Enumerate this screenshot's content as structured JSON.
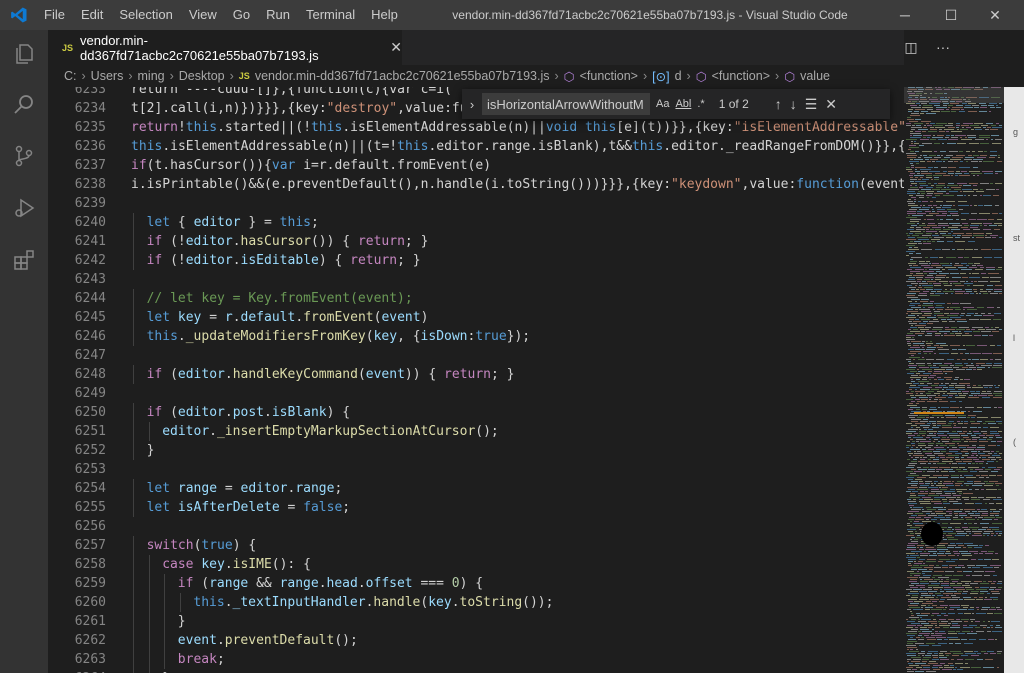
{
  "window": {
    "title": "vendor.min-dd367fd71acbc2c70621e55ba07b7193.js - Visual Studio Code",
    "menu": [
      "File",
      "Edit",
      "Selection",
      "View",
      "Go",
      "Run",
      "Terminal",
      "Help"
    ],
    "controls": {
      "minimize": "─",
      "maximize": "☐",
      "close": "✕"
    }
  },
  "activity_bar": [
    "files-icon",
    "search-icon",
    "source-control-icon",
    "run-debug-icon",
    "extensions-icon"
  ],
  "tab": {
    "badge": "JS",
    "name": "vendor.min-dd367fd71acbc2c70621e55ba07b7193.js",
    "close": "✕",
    "split": "◫",
    "more": "···"
  },
  "breadcrumb": [
    "C:",
    "Users",
    "ming",
    "Desktop",
    "vendor.min-dd367fd71acbc2c70621e55ba07b7193.js",
    "<function>",
    "d",
    "<function>",
    "value"
  ],
  "breadcrumb_js_badge": "JS",
  "find": {
    "query": "isHorizontalArrowWithoutM",
    "match_case": "Aa",
    "whole_word": "Abl",
    "regex": ".*",
    "result": "1 of 2",
    "prev": "↑",
    "next": "↓",
    "selection": "☰",
    "close": "✕",
    "toggle": "›"
  },
  "scroll_strip_marks": [
    "g",
    "st",
    "l",
    "("
  ],
  "colors": {
    "accent": "#007acc",
    "editor_bg": "#1e1e1e",
    "titlebar": "#3c3c3c",
    "activity": "#333333",
    "keyword": "#569cd6",
    "control": "#c586c0",
    "variable": "#9cdcfe",
    "function": "#dcdcaa",
    "string": "#ce9178",
    "comment": "#6a9955"
  },
  "lines": [
    {
      "n": "6233",
      "indent": 0,
      "tokens": [
        [
          "p",
          "return ----cuuu-[]},{function(c){var c=i("
        ]
      ]
    },
    {
      "n": "6234",
      "indent": 0,
      "tokens": [
        [
          "p",
          "t[2].call(i,n)})}}},{key:"
        ],
        [
          "s",
          "\"destroy\""
        ],
        [
          "p",
          ",value:fun"
        ]
      ]
    },
    {
      "n": "6235",
      "indent": 0,
      "tokens": [
        [
          "c",
          "return"
        ],
        [
          "p",
          "!"
        ],
        [
          "k",
          "this"
        ],
        [
          "p",
          ".started||(!"
        ],
        [
          "k",
          "this"
        ],
        [
          "p",
          ".isElementAddressable(n)||"
        ],
        [
          "k",
          "void this"
        ],
        [
          "p",
          "[e](t))}},{key:"
        ],
        [
          "s",
          "\"isElementAddressable\""
        ],
        [
          "p",
          ","
        ]
      ]
    },
    {
      "n": "6236",
      "indent": 0,
      "tokens": [
        [
          "k",
          "this"
        ],
        [
          "p",
          ".isElementAddressable(n)||(t=!"
        ],
        [
          "k",
          "this"
        ],
        [
          "p",
          ".editor.range.isBlank),t&&"
        ],
        [
          "k",
          "this"
        ],
        [
          "p",
          ".editor._readRangeFromDOM()}},{k"
        ]
      ]
    },
    {
      "n": "6237",
      "indent": 0,
      "tokens": [
        [
          "c",
          "if"
        ],
        [
          "p",
          "(t.hasCursor()){"
        ],
        [
          "k",
          "var"
        ],
        [
          "p",
          " i=r.default.fromEvent(e)"
        ]
      ]
    },
    {
      "n": "6238",
      "indent": 0,
      "tokens": [
        [
          "p",
          "i.isPrintable()&&(e.preventDefault(),n.handle(i.toString()))}}},{key:"
        ],
        [
          "s",
          "\"keydown\""
        ],
        [
          "p",
          ",value:"
        ],
        [
          "k",
          "function"
        ],
        [
          "p",
          "(event)"
        ]
      ]
    },
    {
      "n": "6239",
      "indent": 0,
      "tokens": []
    },
    {
      "n": "6240",
      "indent": 1,
      "tokens": [
        [
          "k",
          "let"
        ],
        [
          "p",
          " { "
        ],
        [
          "v",
          "editor"
        ],
        [
          "p",
          " } = "
        ],
        [
          "k",
          "this"
        ],
        [
          "p",
          ";"
        ]
      ]
    },
    {
      "n": "6241",
      "indent": 1,
      "tokens": [
        [
          "c",
          "if"
        ],
        [
          "p",
          " (!"
        ],
        [
          "v",
          "editor"
        ],
        [
          "p",
          "."
        ],
        [
          "f",
          "hasCursor"
        ],
        [
          "p",
          "()) { "
        ],
        [
          "c",
          "return"
        ],
        [
          "p",
          "; }"
        ]
      ]
    },
    {
      "n": "6242",
      "indent": 1,
      "tokens": [
        [
          "c",
          "if"
        ],
        [
          "p",
          " (!"
        ],
        [
          "v",
          "editor"
        ],
        [
          "p",
          "."
        ],
        [
          "v",
          "isEditable"
        ],
        [
          "p",
          ") { "
        ],
        [
          "c",
          "return"
        ],
        [
          "p",
          "; }"
        ]
      ]
    },
    {
      "n": "6243",
      "indent": 0,
      "tokens": []
    },
    {
      "n": "6244",
      "indent": 1,
      "tokens": [
        [
          "cm",
          "// let key = Key.fromEvent(event);"
        ]
      ]
    },
    {
      "n": "6245",
      "indent": 1,
      "tokens": [
        [
          "k",
          "let"
        ],
        [
          "p",
          " "
        ],
        [
          "v",
          "key"
        ],
        [
          "p",
          " = "
        ],
        [
          "v",
          "r"
        ],
        [
          "p",
          "."
        ],
        [
          "v",
          "default"
        ],
        [
          "p",
          "."
        ],
        [
          "f",
          "fromEvent"
        ],
        [
          "p",
          "("
        ],
        [
          "v",
          "event"
        ],
        [
          "p",
          ")"
        ]
      ]
    },
    {
      "n": "6246",
      "indent": 1,
      "tokens": [
        [
          "k",
          "this"
        ],
        [
          "p",
          "."
        ],
        [
          "f",
          "_updateModifiersFromKey"
        ],
        [
          "p",
          "("
        ],
        [
          "v",
          "key"
        ],
        [
          "p",
          ", {"
        ],
        [
          "v",
          "isDown"
        ],
        [
          "p",
          ":"
        ],
        [
          "k",
          "true"
        ],
        [
          "p",
          "});"
        ]
      ]
    },
    {
      "n": "6247",
      "indent": 0,
      "tokens": []
    },
    {
      "n": "6248",
      "indent": 1,
      "tokens": [
        [
          "c",
          "if"
        ],
        [
          "p",
          " ("
        ],
        [
          "v",
          "editor"
        ],
        [
          "p",
          "."
        ],
        [
          "f",
          "handleKeyCommand"
        ],
        [
          "p",
          "("
        ],
        [
          "v",
          "event"
        ],
        [
          "p",
          ")) { "
        ],
        [
          "c",
          "return"
        ],
        [
          "p",
          "; }"
        ]
      ]
    },
    {
      "n": "6249",
      "indent": 0,
      "tokens": []
    },
    {
      "n": "6250",
      "indent": 1,
      "tokens": [
        [
          "c",
          "if"
        ],
        [
          "p",
          " ("
        ],
        [
          "v",
          "editor"
        ],
        [
          "p",
          "."
        ],
        [
          "v",
          "post"
        ],
        [
          "p",
          "."
        ],
        [
          "v",
          "isBlank"
        ],
        [
          "p",
          ") {"
        ]
      ]
    },
    {
      "n": "6251",
      "indent": 2,
      "tokens": [
        [
          "v",
          "editor"
        ],
        [
          "p",
          "."
        ],
        [
          "f",
          "_insertEmptyMarkupSectionAtCursor"
        ],
        [
          "p",
          "();"
        ]
      ]
    },
    {
      "n": "6252",
      "indent": 1,
      "tokens": [
        [
          "p",
          "}"
        ]
      ]
    },
    {
      "n": "6253",
      "indent": 0,
      "tokens": []
    },
    {
      "n": "6254",
      "indent": 1,
      "tokens": [
        [
          "k",
          "let"
        ],
        [
          "p",
          " "
        ],
        [
          "v",
          "range"
        ],
        [
          "p",
          " = "
        ],
        [
          "v",
          "editor"
        ],
        [
          "p",
          "."
        ],
        [
          "v",
          "range"
        ],
        [
          "p",
          ";"
        ]
      ]
    },
    {
      "n": "6255",
      "indent": 1,
      "tokens": [
        [
          "k",
          "let"
        ],
        [
          "p",
          " "
        ],
        [
          "v",
          "isAfterDelete"
        ],
        [
          "p",
          " = "
        ],
        [
          "k",
          "false"
        ],
        [
          "p",
          ";"
        ]
      ]
    },
    {
      "n": "6256",
      "indent": 0,
      "tokens": []
    },
    {
      "n": "6257",
      "indent": 1,
      "tokens": [
        [
          "c",
          "switch"
        ],
        [
          "p",
          "("
        ],
        [
          "k",
          "true"
        ],
        [
          "p",
          ") {"
        ]
      ]
    },
    {
      "n": "6258",
      "indent": 2,
      "tokens": [
        [
          "c",
          "case"
        ],
        [
          "p",
          " "
        ],
        [
          "v",
          "key"
        ],
        [
          "p",
          "."
        ],
        [
          "f",
          "isIME"
        ],
        [
          "p",
          "(): {"
        ]
      ]
    },
    {
      "n": "6259",
      "indent": 3,
      "tokens": [
        [
          "c",
          "if"
        ],
        [
          "p",
          " ("
        ],
        [
          "v",
          "range"
        ],
        [
          "p",
          " && "
        ],
        [
          "v",
          "range"
        ],
        [
          "p",
          "."
        ],
        [
          "v",
          "head"
        ],
        [
          "p",
          "."
        ],
        [
          "v",
          "offset"
        ],
        [
          "p",
          " === "
        ],
        [
          "n",
          "0"
        ],
        [
          "p",
          ") {"
        ]
      ]
    },
    {
      "n": "6260",
      "indent": 4,
      "tokens": [
        [
          "k",
          "this"
        ],
        [
          "p",
          "."
        ],
        [
          "v",
          "_textInputHandler"
        ],
        [
          "p",
          "."
        ],
        [
          "f",
          "handle"
        ],
        [
          "p",
          "("
        ],
        [
          "v",
          "key"
        ],
        [
          "p",
          "."
        ],
        [
          "f",
          "toString"
        ],
        [
          "p",
          "());"
        ]
      ]
    },
    {
      "n": "6261",
      "indent": 3,
      "tokens": [
        [
          "p",
          "}"
        ]
      ]
    },
    {
      "n": "6262",
      "indent": 3,
      "tokens": [
        [
          "v",
          "event"
        ],
        [
          "p",
          "."
        ],
        [
          "f",
          "preventDefault"
        ],
        [
          "p",
          "();"
        ]
      ]
    },
    {
      "n": "6263",
      "indent": 3,
      "tokens": [
        [
          "c",
          "break"
        ],
        [
          "p",
          ";"
        ]
      ]
    },
    {
      "n": "6264",
      "indent": 2,
      "tokens": [
        [
          "p",
          "}"
        ]
      ]
    }
  ]
}
